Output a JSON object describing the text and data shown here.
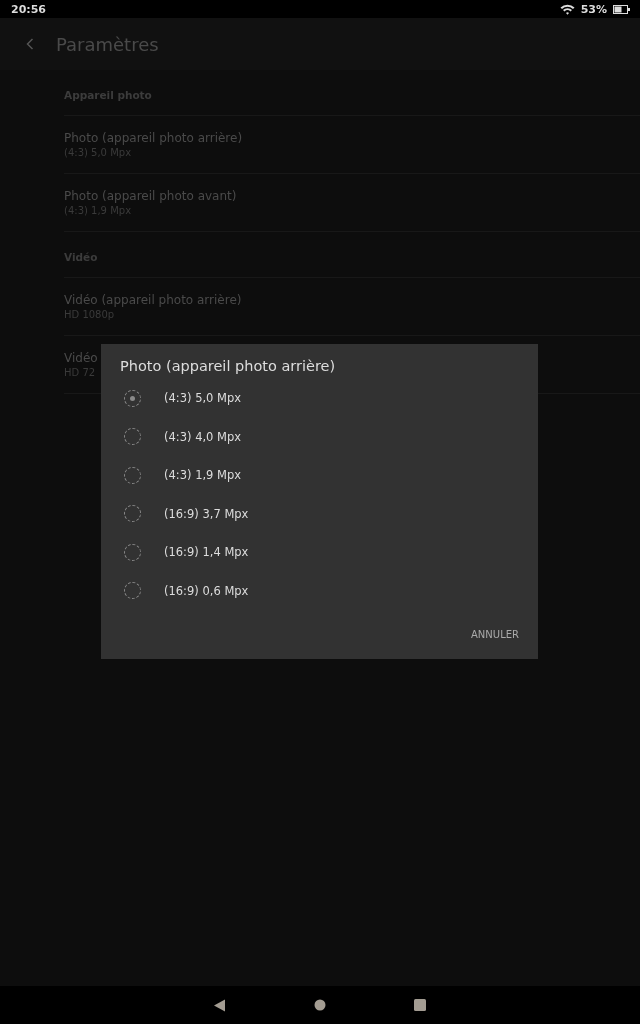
{
  "status_bar": {
    "time": "20:56",
    "battery": "53%"
  },
  "header": {
    "title": "Paramètres"
  },
  "sections": [
    {
      "title": "Appareil photo",
      "items": [
        {
          "title": "Photo (appareil photo arrière)",
          "value": "(4:3) 5,0 Mpx"
        },
        {
          "title": "Photo (appareil photo avant)",
          "value": "(4:3) 1,9 Mpx"
        }
      ]
    },
    {
      "title": "Vidéo",
      "items": [
        {
          "title": "Vidéo (appareil photo arrière)",
          "value": "HD 1080p"
        },
        {
          "title": "Vidéo",
          "value": "HD 72"
        }
      ]
    }
  ],
  "dialog": {
    "title": "Photo (appareil photo arrière)",
    "options": [
      {
        "label": "(4:3) 5,0 Mpx",
        "selected": true
      },
      {
        "label": "(4:3) 4,0 Mpx",
        "selected": false
      },
      {
        "label": "(4:3) 1,9 Mpx",
        "selected": false
      },
      {
        "label": "(16:9) 3,7 Mpx",
        "selected": false
      },
      {
        "label": "(16:9) 1,4 Mpx",
        "selected": false
      },
      {
        "label": "(16:9) 0,6 Mpx",
        "selected": false
      }
    ],
    "buttons": [
      "ANNULER"
    ]
  }
}
